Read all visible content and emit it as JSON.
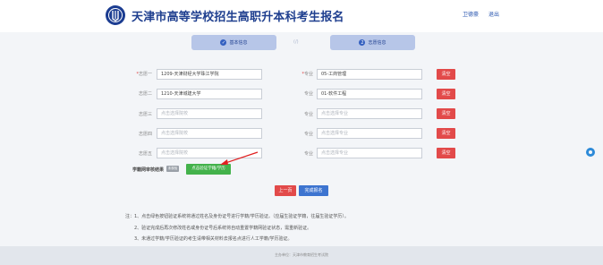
{
  "header": {
    "site_title": "天津市高等学校招生高职升本科考生报名",
    "user_name": "卫德豪",
    "logout": "退出"
  },
  "steps": [
    {
      "label": "基本信息",
      "badge": "✓"
    },
    {
      "label": "志愿信息",
      "badge": "2"
    }
  ],
  "step_separator": "(/)",
  "volunteers": [
    {
      "school_label": "志愿一",
      "required": true,
      "school": "1209-天津财经大学珠江学院",
      "school_placeholder": "",
      "major_label": "专业",
      "major": "05-工商管理",
      "major_placeholder": ""
    },
    {
      "school_label": "志愿二",
      "required": false,
      "school": "1210-天津城建大学",
      "school_placeholder": "",
      "major_label": "专业",
      "major": "01-软件工程",
      "major_placeholder": ""
    },
    {
      "school_label": "志愿三",
      "required": false,
      "school": "",
      "school_placeholder": "点击选择院校",
      "major_label": "专业",
      "major": "",
      "major_placeholder": "点击选择专业"
    },
    {
      "school_label": "志愿四",
      "required": false,
      "school": "",
      "school_placeholder": "点击选择院校",
      "major_label": "专业",
      "major": "",
      "major_placeholder": "点击选择专业"
    },
    {
      "school_label": "志愿五",
      "required": false,
      "school": "",
      "school_placeholder": "点击选择院校",
      "major_label": "专业",
      "major": "",
      "major_placeholder": "点击选择专业"
    }
  ],
  "clear_label": "清空",
  "verification": {
    "label": "学籍网审核结果",
    "status": "未核验",
    "button": "点击验证学籍/学历"
  },
  "buttons": {
    "prev": "上一页",
    "submit": "完成报名"
  },
  "notes": [
    "注：1、点击绿色按钮验证系统将通过姓名及身份证号进行学籍/学历验证。（应届生验证学籍，往届生验证学历）。",
    "2、验证完成后再次修改姓名或身份证号后系统将自动重置学籍网验证状态，需重新验证。",
    "3、未通过学籍/学历验证的考生请带相关材料去报名点进行人工学籍/学历验证。"
  ],
  "footer": "主办单位：天津市教育招生考试院",
  "colors": {
    "brand": "#1f3f8f",
    "danger": "#e24a4a",
    "success": "#43b24b",
    "primary": "#3d74d0"
  }
}
